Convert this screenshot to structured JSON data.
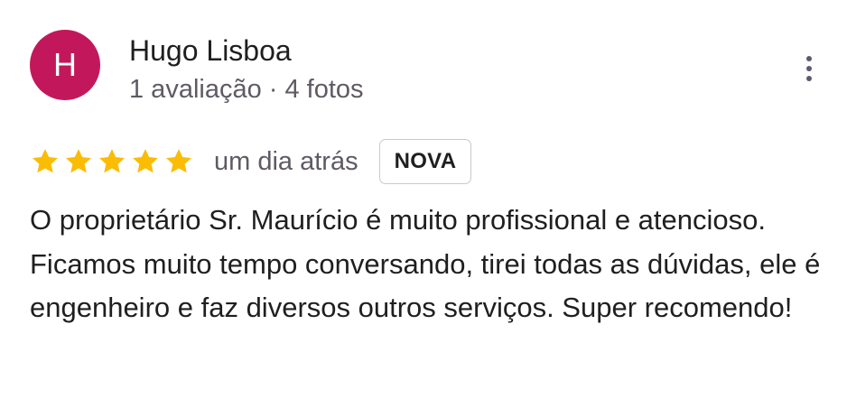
{
  "reviewer": {
    "initial": "H",
    "avatar_color": "#c2185b",
    "name": "Hugo Lisboa",
    "meta": "1 avaliação · 4 fotos"
  },
  "menu": {
    "icon": "more-vert-icon"
  },
  "review": {
    "rating": 5,
    "rating_max": 5,
    "star_color": "#fbbc04",
    "time": "um dia atrás",
    "badge": "NOVA",
    "text": "O proprietário Sr. Maurício é muito profissional e atencioso. Ficamos muito tempo conversando, tirei todas as dúvidas, ele é engenheiro e faz diversos outros serviços. Super recomendo!"
  }
}
